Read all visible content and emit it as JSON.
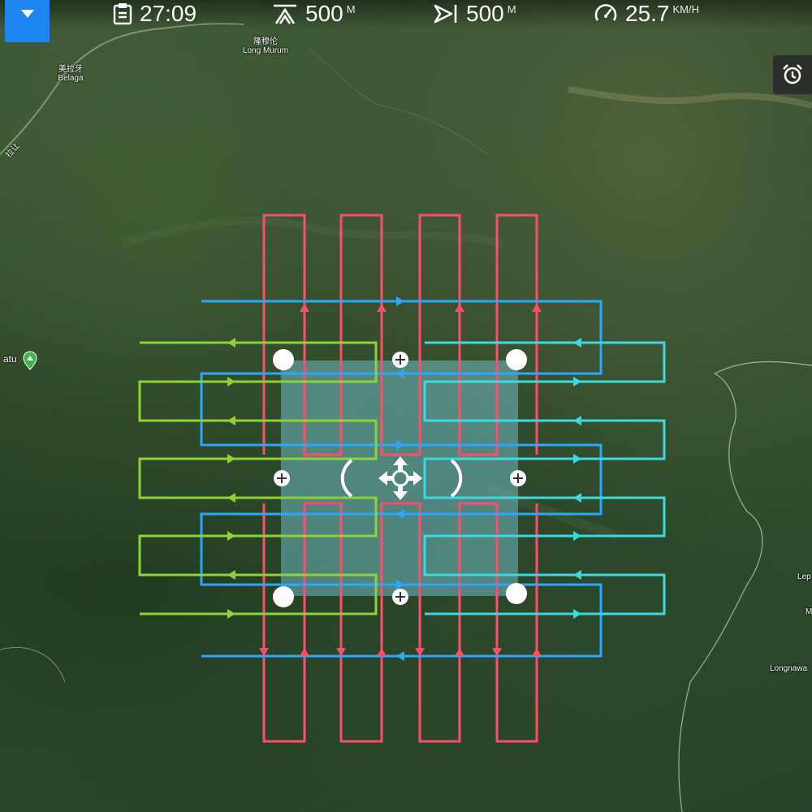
{
  "header": {
    "time": "27:09",
    "altitude_value": "500",
    "altitude_unit": "M",
    "distance_value": "500",
    "distance_unit": "M",
    "speed_value": "25.7",
    "speed_unit": "KM/H"
  },
  "icons": {
    "menu": "dropdown-triangle-icon",
    "time": "clipboard-icon",
    "altitude": "altitude-icon",
    "distance": "distance-icon",
    "speed": "speedometer-icon",
    "alarm": "alarm-clock-icon",
    "move": "move-arrows-icon",
    "map_pin": "map-pin-icon"
  },
  "map": {
    "places": {
      "long_murum_cn": "隆穆伦",
      "long_murum": "Long Murum",
      "belaga_cn": "美拉牙",
      "belaga": "Belaga",
      "road": "拉让",
      "atu": "atu",
      "lep": "Lep",
      "m": "M",
      "longnawa": "Longnawa"
    }
  },
  "colors": {
    "accent": "#1d86f0",
    "path_red": "#ff4d6a",
    "path_blue": "#2aa8ff",
    "path_green": "#8fd13a",
    "path_cyan": "#3fd8e0",
    "area_fill": "#7fd3e6"
  }
}
